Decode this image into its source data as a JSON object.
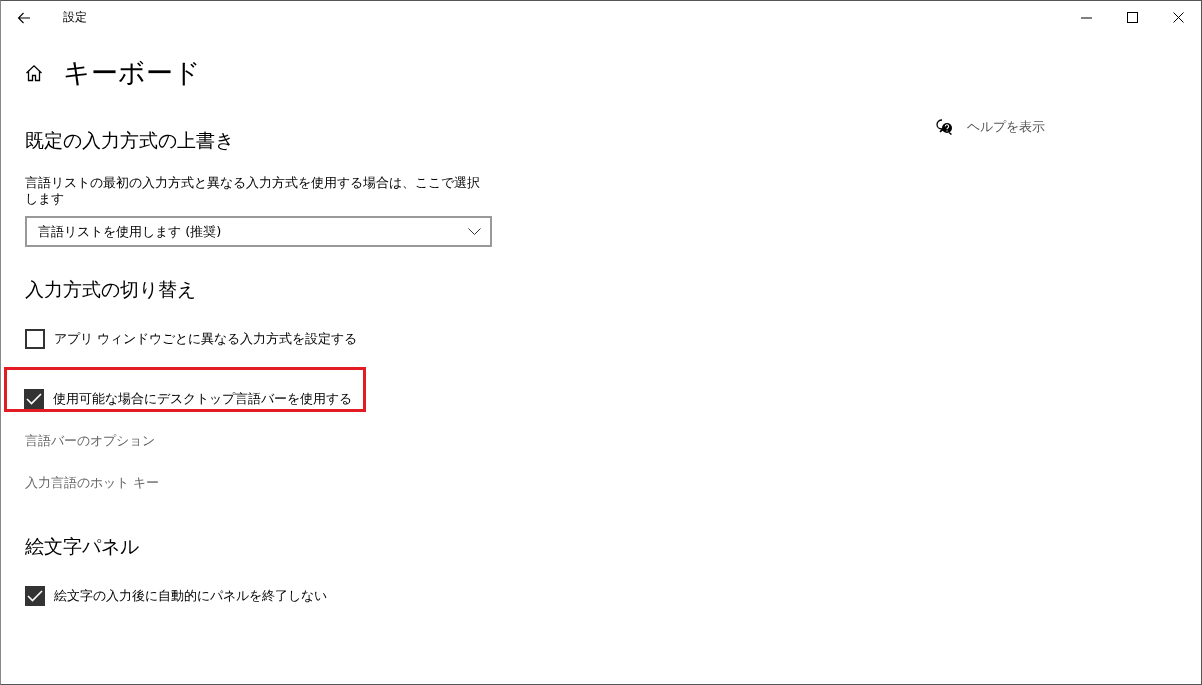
{
  "window": {
    "title": "設定"
  },
  "page": {
    "title": "キーボード"
  },
  "help": {
    "label": "ヘルプを表示"
  },
  "sections": [
    {
      "heading": "既定の入力方式の上書き",
      "items": [
        {
          "kind": "text",
          "text": "言語リストの最初の入力方式と異なる入力方式を使用する場合は、ここで選択します"
        },
        {
          "kind": "dropdown",
          "value": "言語リストを使用します (推奨)"
        }
      ]
    },
    {
      "heading": "入力方式の切り替え",
      "items": [
        {
          "kind": "checkbox",
          "label": "アプリ ウィンドウごとに異なる入力方式を設定する",
          "checked": false,
          "highlighted": false
        },
        {
          "kind": "checkbox",
          "label": "使用可能な場合にデスクトップ言語バーを使用する",
          "checked": true,
          "highlighted": true
        },
        {
          "kind": "link",
          "label": "言語バーのオプション"
        },
        {
          "kind": "link",
          "label": "入力言語のホット キー"
        }
      ]
    },
    {
      "heading": "絵文字パネル",
      "items": [
        {
          "kind": "checkbox",
          "label": "絵文字の入力後に自動的にパネルを終了しない",
          "checked": true,
          "highlighted": false
        }
      ]
    }
  ]
}
